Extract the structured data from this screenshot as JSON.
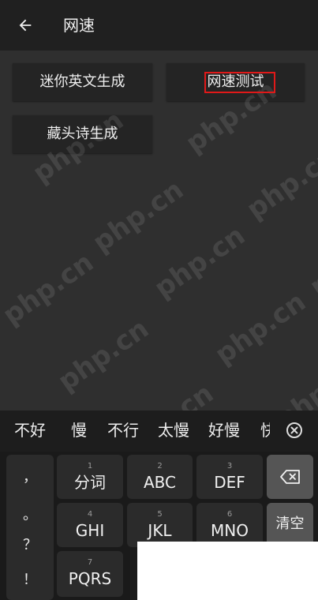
{
  "app_bar": {
    "back_icon": "arrow-left-icon",
    "title": "网速"
  },
  "tools": [
    {
      "label": "迷你英文生成"
    },
    {
      "label": "网速测试",
      "highlighted": true
    },
    {
      "label": "藏头诗生成"
    }
  ],
  "watermark": "php.cn",
  "ime": {
    "suggestions": [
      "不好",
      "慢",
      "不行",
      "太慢",
      "好慢",
      "快"
    ],
    "close_icon": "close-circle-icon",
    "punctuation": [
      "，",
      "。",
      "？",
      "！"
    ],
    "keys": [
      {
        "num": "1",
        "label": "分词"
      },
      {
        "num": "2",
        "label": "ABC"
      },
      {
        "num": "3",
        "label": "DEF"
      },
      {
        "num": "4",
        "label": "GHI"
      },
      {
        "num": "5",
        "label": "JKL"
      },
      {
        "num": "6",
        "label": "MNO"
      },
      {
        "num": "7",
        "label": "PQRS"
      }
    ],
    "delete_icon": "backspace-icon",
    "clear_label": "清空"
  },
  "colors": {
    "app_bar_bg": "#202020",
    "content_bg": "#2f2f2f",
    "card_bg": "#242424",
    "highlight_border": "#e01919",
    "keyboard_bg": "#1a1a1a",
    "key_bg": "#2b2b2b",
    "function_key_bg": "#555555"
  }
}
